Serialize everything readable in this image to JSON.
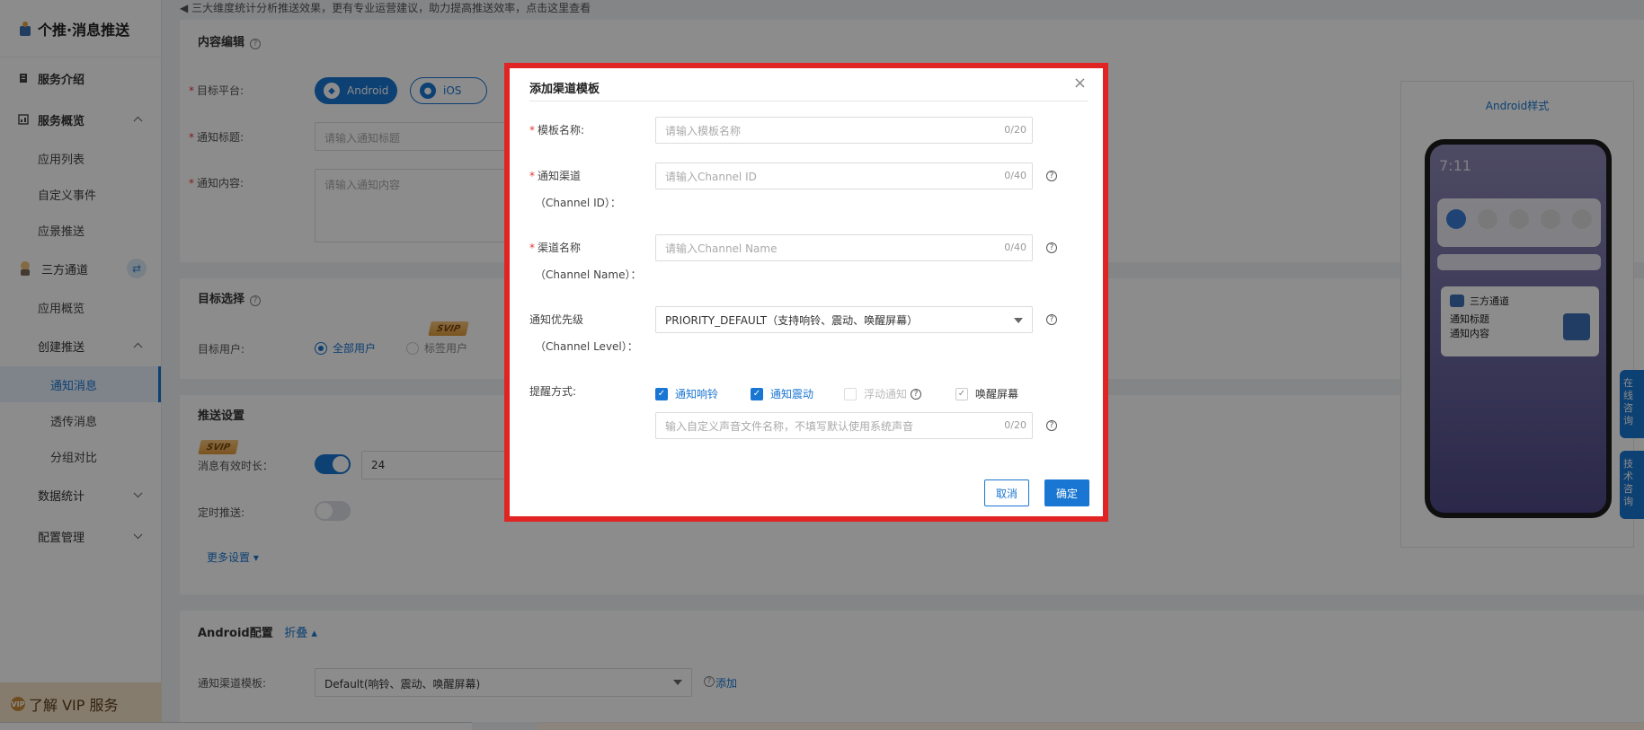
{
  "app": {
    "title": "个推·消息推送"
  },
  "sidebar": {
    "groups": [
      {
        "label": "服务介绍"
      },
      {
        "label": "服务概览"
      },
      {
        "label": "三方通道"
      },
      {
        "label": "数据统计"
      },
      {
        "label": "配置管理"
      }
    ],
    "items": {
      "app_list": "应用列表",
      "custom_events": "自定义事件",
      "scene_push": "应景推送",
      "app_overview": "应用概览",
      "create_push": "创建推送",
      "notify_msg": "通知消息",
      "passthrough_msg": "透传消息",
      "group_compare": "分组对比"
    },
    "vip_label": "了解 VIP 服务",
    "vip_badge": "VIP"
  },
  "topbar": {
    "notice": "三大维度统计分析推送效果，更有专业运营建议，助力提高推送效率，点击这里查看"
  },
  "content_edit": {
    "title": "内容编辑",
    "platform_label": "目标平台:",
    "android": "Android",
    "ios": "iOS",
    "notify_title_label": "通知标题:",
    "notify_title_placeholder": "请输入通知标题",
    "notify_content_label": "通知内容:",
    "notify_content_placeholder": "请输入通知内容"
  },
  "target": {
    "title": "目标选择",
    "users_label": "目标用户:",
    "all_users": "全部用户",
    "tag_users": "标签用户",
    "svip": "SVIP"
  },
  "push_settings": {
    "title": "推送设置",
    "svip": "SVIP",
    "ttl_label": "消息有效时长：",
    "ttl_value": "24",
    "timed_label": "定时推送:",
    "more": "更多设置"
  },
  "android_config": {
    "title": "Android配置",
    "collapse": "折叠",
    "channel_template_label": "通知渠道模板:",
    "channel_template_value": "Default(响铃、震动、唤醒屏幕)",
    "add": "添加"
  },
  "preview": {
    "title": "Android样式",
    "time": "7:11",
    "app_name": "三方通道",
    "notify_title": "通知标题",
    "notify_content": "通知内容"
  },
  "float": {
    "online": "在线咨询",
    "tech": "技术咨询"
  },
  "modal": {
    "title": "添加渠道模板",
    "close": "×",
    "template_name_label": "模板名称:",
    "template_name_placeholder": "请输入模板名称",
    "template_name_count": "0/20",
    "channel_id_label": "通知渠道",
    "channel_id_sub": "（Channel ID）：",
    "channel_id_placeholder": "请输入Channel ID",
    "channel_id_count": "0/40",
    "channel_name_label": "渠道名称",
    "channel_name_sub": "（Channel Name）：",
    "channel_name_placeholder": "请输入Channel Name",
    "channel_name_count": "0/40",
    "priority_label": "通知优先级",
    "priority_sub": "（Channel Level）：",
    "priority_value": "PRIORITY_DEFAULT（支持响铃、震动、唤醒屏幕）",
    "remind_label": "提醒方式:",
    "opt_ring": "通知响铃",
    "opt_vibrate": "通知震动",
    "opt_float": "浮动通知",
    "opt_wake": "唤醒屏幕",
    "sound_placeholder": "输入自定义声音文件名称，不填写默认使用系统声音",
    "sound_count": "0/20",
    "cancel": "取消",
    "ok": "确定"
  },
  "colors": {
    "accent": "#1976d2",
    "highlight_border": "#e02323",
    "required": "#e53935"
  }
}
